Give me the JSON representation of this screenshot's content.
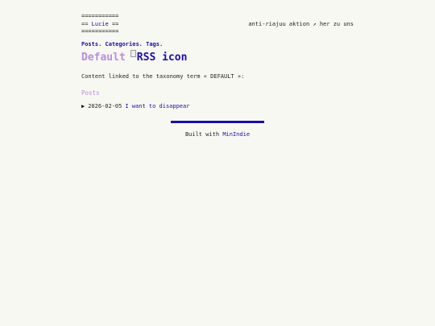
{
  "header": {
    "rule": "===========",
    "brand_prefix": "== ",
    "brand_name": "Lucie",
    "brand_suffix": " ==",
    "tagline": "anti-riajuu aktion ↗ her zu uns"
  },
  "nav": {
    "items": [
      {
        "label": "Posts"
      },
      {
        "label": "Categories"
      },
      {
        "label": "Tags"
      }
    ],
    "separator": ".",
    "end": "."
  },
  "main": {
    "title": "Default",
    "rss_alt": "RSS icon",
    "intro": "Content linked to the taxonomy term « DEFAULT »:",
    "section_title": "Posts",
    "posts": [
      {
        "bullet": "▶",
        "date": "2026-02-05",
        "title": "I want to disappear"
      }
    ]
  },
  "footer": {
    "built_with": "Built with",
    "link": "MinIndie"
  },
  "colors": {
    "background": "#f8f8f3",
    "link": "#1a0dab",
    "heading": "#b78ee0",
    "divider": "#1a0dab"
  }
}
